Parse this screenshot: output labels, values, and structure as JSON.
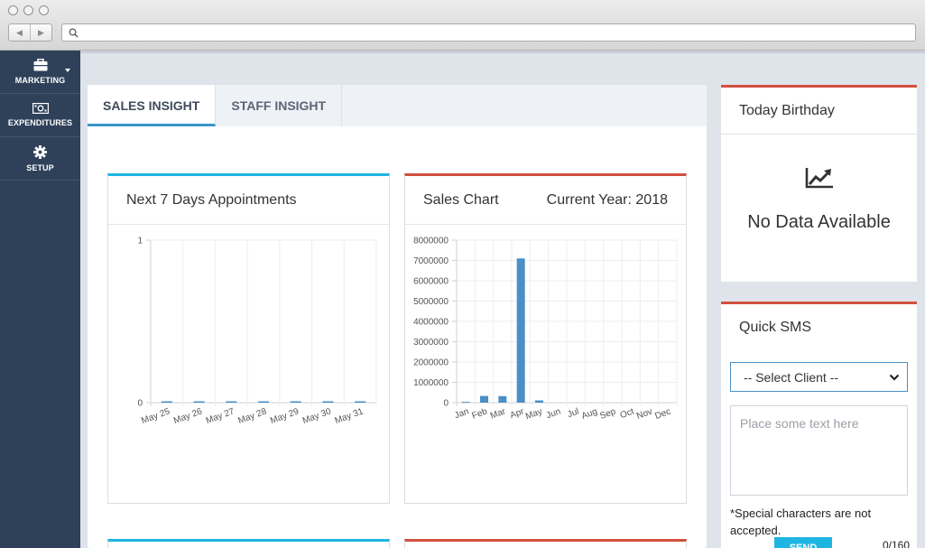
{
  "browser": {
    "back_glyph": "◀",
    "forward_glyph": "▶",
    "address": ""
  },
  "sidebar": {
    "items": [
      {
        "label": "MARKETING",
        "icon": "briefcase-icon"
      },
      {
        "label": "EXPENDITURES",
        "icon": "money-icon"
      },
      {
        "label": "SETUP",
        "icon": "gear-icon"
      }
    ]
  },
  "tabs": [
    {
      "label": "SALES INSIGHT",
      "active": true
    },
    {
      "label": "STAFF INSIGHT",
      "active": false
    }
  ],
  "appointments_card": {
    "title": "Next 7 Days Appointments"
  },
  "sales_card": {
    "title": "Sales Chart",
    "year_label": "Current Year: 2018"
  },
  "birthday_card": {
    "title": "Today Birthday",
    "empty_text": "No Data Available",
    "icon": "line-chart-icon"
  },
  "sms_card": {
    "title": "Quick SMS",
    "select_value": "-- Select Client --",
    "textarea_placeholder": "Place some text here",
    "note": "*Special characters are not accepted.",
    "send_label": "SEND",
    "counter": "0/160"
  },
  "colors": {
    "sidebar_bg": "#2f4159",
    "accent_blue": "#1fb5e3",
    "accent_red": "#d2503e",
    "bar_color": "#4a8fc7",
    "page_bg": "#dfe3ea"
  },
  "chart_data": [
    {
      "type": "bar",
      "categories": [
        "May 25",
        "May 26",
        "May 27",
        "May 28",
        "May 29",
        "May 30",
        "May 31"
      ],
      "values": [
        0,
        0,
        0,
        0,
        0,
        0,
        0
      ],
      "ylim": [
        0,
        1
      ],
      "yticks": [
        "1",
        "0"
      ],
      "grid": true
    },
    {
      "type": "bar",
      "categories": [
        "Jan",
        "Feb",
        "Mar",
        "Apr",
        "May",
        "Jun",
        "Jul",
        "Aug",
        "Sep",
        "Oct",
        "Nov",
        "Dec"
      ],
      "values": [
        40000,
        330000,
        320000,
        7100000,
        110000,
        0,
        0,
        0,
        0,
        0,
        0,
        0
      ],
      "ylim": [
        0,
        8000000
      ],
      "yticks": [
        "8000000",
        "7000000",
        "6000000",
        "5000000",
        "4000000",
        "3000000",
        "2000000",
        "1000000",
        "0"
      ],
      "grid": true
    }
  ]
}
